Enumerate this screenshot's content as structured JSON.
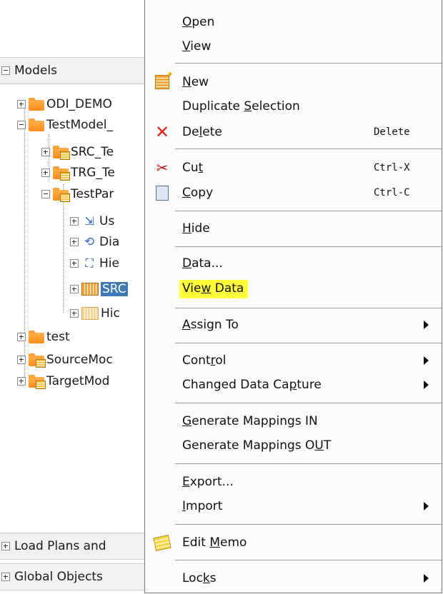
{
  "tree": {
    "models_header": "Models",
    "nodes": [
      {
        "label": "ODI_DEMO",
        "icon": "model-folder-icon"
      },
      {
        "label": "TestModel_",
        "icon": "model-folder-icon"
      },
      {
        "label": "SRC_Te",
        "icon": "submodel-folder-icon"
      },
      {
        "label": "TRG_Te",
        "icon": "submodel-folder-icon"
      },
      {
        "label": "TestPar",
        "icon": "submodel-folder-icon"
      },
      {
        "label": "Us",
        "icon": "user-function-icon"
      },
      {
        "label": "Dia",
        "icon": "diagram-icon"
      },
      {
        "label": "Hie",
        "icon": "hierarchy-icon"
      },
      {
        "label": "SRC",
        "icon": "datastore-icon",
        "selected": true
      },
      {
        "label": "Hic",
        "icon": "datastore-icon"
      },
      {
        "label": "test",
        "icon": "model-folder-icon"
      },
      {
        "label": "SourceMoc",
        "icon": "submodel-folder-icon"
      },
      {
        "label": "TargetMod",
        "icon": "submodel-folder-icon"
      }
    ],
    "load_plans_header": "Load Plans and",
    "global_objects_header": "Global Objects"
  },
  "menu": {
    "items": [
      {
        "label": "Open",
        "mnemonic": "O"
      },
      {
        "label": "View",
        "mnemonic": "V"
      },
      {
        "label": "New",
        "mnemonic": "N",
        "icon": "new-icon"
      },
      {
        "label": "Duplicate Selection",
        "mnemonic": "S"
      },
      {
        "label": "Delete",
        "mnemonic": "l",
        "icon": "delete-icon",
        "accelerator": "Delete"
      },
      {
        "label": "Cut",
        "mnemonic": "t",
        "icon": "cut-icon",
        "accelerator": "Ctrl-X"
      },
      {
        "label": "Copy",
        "mnemonic": "C",
        "icon": "copy-icon",
        "accelerator": "Ctrl-C"
      },
      {
        "label": "Hide",
        "mnemonic": "H"
      },
      {
        "label": "Data...",
        "mnemonic": "D"
      },
      {
        "label": "View Data",
        "mnemonic": "w",
        "highlighted": true
      },
      {
        "label": "Assign To",
        "mnemonic": "A",
        "submenu": true
      },
      {
        "label": "Control",
        "mnemonic": "r",
        "submenu": true
      },
      {
        "label": "Changed Data Capture",
        "mnemonic": "p",
        "submenu": true
      },
      {
        "label": "Generate Mappings IN",
        "mnemonic": "G"
      },
      {
        "label": "Generate Mappings OUT",
        "mnemonic": "U"
      },
      {
        "label": "Export...",
        "mnemonic": "E"
      },
      {
        "label": "Import",
        "mnemonic": "I",
        "submenu": true
      },
      {
        "label": "Edit Memo",
        "mnemonic": "M",
        "icon": "memo-icon"
      },
      {
        "label": "Locks",
        "mnemonic": "k",
        "submenu": true
      }
    ]
  },
  "colors": {
    "highlight": "#ffff3a",
    "selection": "#3f79b5",
    "folder": "#ff8a1a"
  }
}
